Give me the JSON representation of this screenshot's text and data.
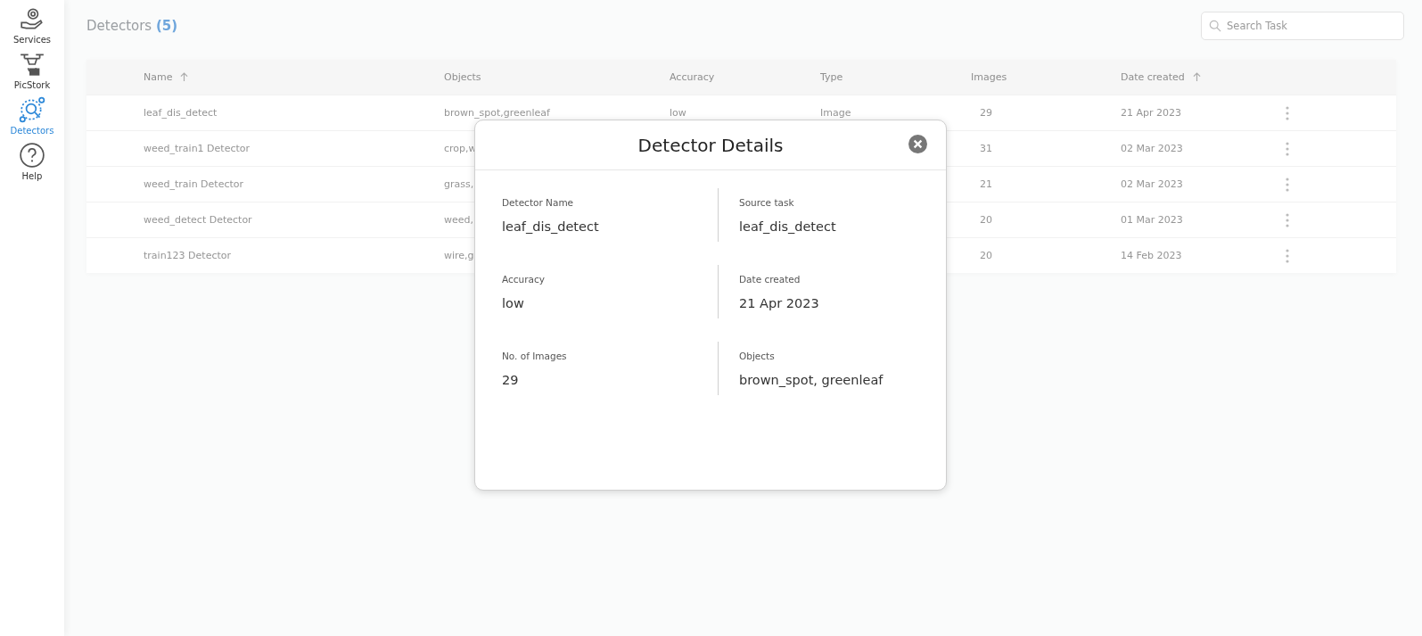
{
  "sidebar": {
    "items": [
      {
        "label": "Services",
        "selected": false
      },
      {
        "label": "PicStork",
        "selected": false
      },
      {
        "label": "Detectors",
        "selected": true
      },
      {
        "label": "Help",
        "selected": false
      }
    ]
  },
  "header": {
    "title": "Detectors",
    "count": "(5)"
  },
  "search": {
    "placeholder": "Search Task"
  },
  "table": {
    "columns": [
      {
        "label": "Name",
        "sorted": true
      },
      {
        "label": "Objects",
        "sorted": false
      },
      {
        "label": "Accuracy",
        "sorted": false
      },
      {
        "label": "Type",
        "sorted": false
      },
      {
        "label": "Images",
        "sorted": false
      },
      {
        "label": "Date created",
        "sorted": true
      }
    ],
    "rows": [
      {
        "name": "leaf_dis_detect",
        "objects": "brown_spot,greenleaf",
        "accuracy": "low",
        "type": "Image",
        "images": "29",
        "date": "21 Apr 2023"
      },
      {
        "name": "weed_train1 Detector",
        "objects": "crop,w",
        "images": "31",
        "date": "02 Mar 2023"
      },
      {
        "name": "weed_train Detector",
        "objects": "grass,",
        "images": "21",
        "date": "02 Mar 2023"
      },
      {
        "name": "weed_detect Detector",
        "objects": "weed,",
        "images": "20",
        "date": "01 Mar 2023"
      },
      {
        "name": "train123 Detector",
        "objects": "wire,g",
        "images": "20",
        "date": "14 Feb 2023"
      }
    ]
  },
  "modal": {
    "title": "Detector Details",
    "fields": [
      {
        "label": "Detector Name",
        "value": "leaf_dis_detect"
      },
      {
        "label": "Source task",
        "value": "leaf_dis_detect"
      },
      {
        "label": "Accuracy",
        "value": "low"
      },
      {
        "label": "Date created",
        "value": "21 Apr 2023"
      },
      {
        "label": "No. of Images",
        "value": "29"
      },
      {
        "label": "Objects",
        "value": "brown_spot, greenleaf"
      }
    ]
  }
}
